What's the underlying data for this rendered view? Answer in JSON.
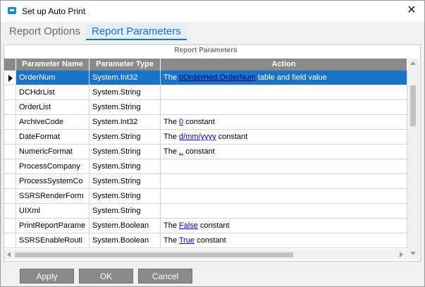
{
  "window": {
    "title": "Set up Auto Print",
    "close_glyph": "✕"
  },
  "tabs": [
    {
      "label": "Report Options",
      "active": false
    },
    {
      "label": "Report Parameters",
      "active": true
    }
  ],
  "grid": {
    "group_header": "Report Parameters",
    "columns": [
      "Parameter Name",
      "Parameter Type",
      "Action"
    ],
    "rows": [
      {
        "name": "OrderNum",
        "type": "System.Int32",
        "action_pre": "The ",
        "action_link": "ttOrderHed.OrderNum",
        "action_post": " table and field value",
        "selected": true
      },
      {
        "name": "DCHdrList",
        "type": "System.String",
        "action_pre": "",
        "action_link": "",
        "action_post": ""
      },
      {
        "name": "OrderList",
        "type": "System.String",
        "action_pre": "",
        "action_link": "",
        "action_post": ""
      },
      {
        "name": "ArchiveCode",
        "type": "System.Int32",
        "action_pre": "The ",
        "action_link": "0",
        "action_post": " constant"
      },
      {
        "name": "DateFormat",
        "type": "System.String",
        "action_pre": "The ",
        "action_link": "d/mm/yyyy",
        "action_post": " constant"
      },
      {
        "name": "NumericFormat",
        "type": "System.String",
        "action_pre": "The ",
        "action_link": ",.",
        "action_post": " constant"
      },
      {
        "name": "ProcessCompany",
        "type": "System.String",
        "action_pre": "",
        "action_link": "",
        "action_post": ""
      },
      {
        "name": "ProcessSystemCo",
        "type": "System.String",
        "action_pre": "",
        "action_link": "",
        "action_post": ""
      },
      {
        "name": "SSRSRenderForm",
        "type": "System.String",
        "action_pre": "",
        "action_link": "",
        "action_post": ""
      },
      {
        "name": "UIXml",
        "type": "System.String",
        "action_pre": "",
        "action_link": "",
        "action_post": ""
      },
      {
        "name": "PrintReportParame",
        "type": "System.Boolean",
        "action_pre": "The ",
        "action_link": "False",
        "action_post": " constant"
      },
      {
        "name": "SSRSEnableRouti",
        "type": "System.Boolean",
        "action_pre": "The ",
        "action_link": "True",
        "action_post": " constant"
      }
    ]
  },
  "buttons": {
    "apply": "Apply",
    "ok": "OK",
    "cancel": "Cancel"
  },
  "colors": {
    "accent": "#1a73c7",
    "header_bg": "#8a8a8a",
    "button_bg": "#8a8a8a"
  }
}
